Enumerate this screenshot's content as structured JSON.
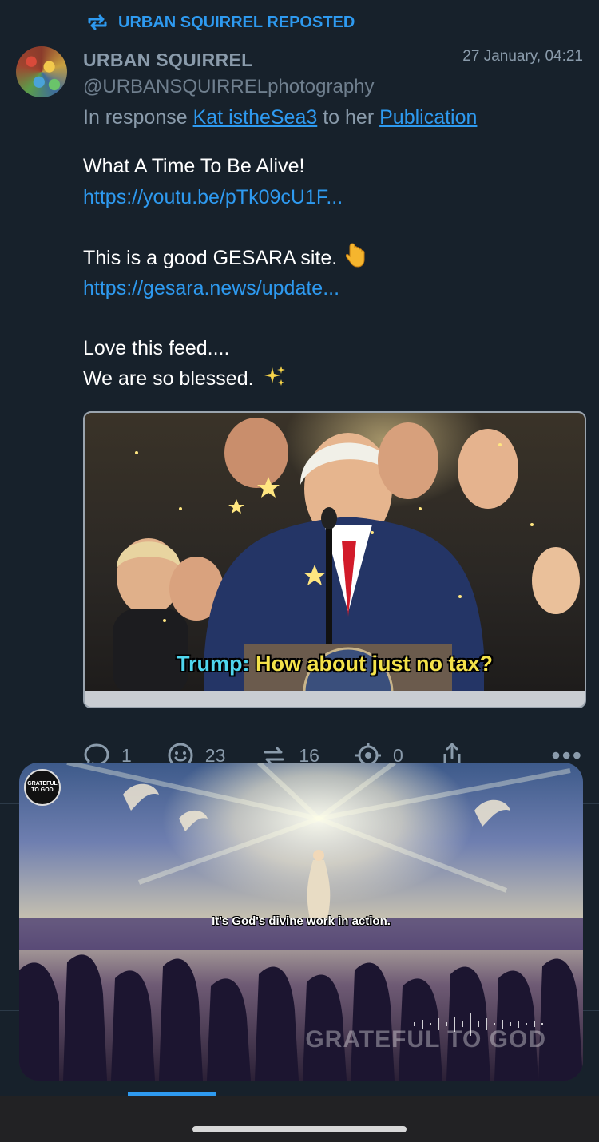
{
  "repost": {
    "label": "URBAN SQUIRREL REPOSTED"
  },
  "post": {
    "author_name": "URBAN SQUIRREL",
    "handle": "@URBANSQUIRRELphotography",
    "timestamp": "27 January, 04:21",
    "reply": {
      "prefix": "In response",
      "user_link": "Kat istheSea3",
      "middle": "to her",
      "publication_link": "Publication"
    },
    "text_line_1": "What A Time To Be Alive!",
    "link_1": "https://youtu.be/pTk09cU1F...",
    "text_line_2": "This is a good GESARA site.",
    "link_2": "https://gesara.news/update...",
    "text_line_3": "Love this feed....",
    "text_line_4": "We are so blessed.",
    "media": {
      "caption_speaker": "Trump:",
      "caption_text": " How about just no tax?"
    },
    "actions": {
      "comments": "1",
      "reactions": "23",
      "reposts": "16",
      "targets": "0"
    }
  },
  "video_overlay": {
    "channel_logo": "GRATEFUL TO GOD",
    "subtitle": "It's God's divine work in action.",
    "watermark": "GRATEFUL TO GOD"
  },
  "colors": {
    "background": "#17212b",
    "accent": "#2e9af0",
    "muted": "#8a9bab",
    "caption_yellow": "#f4e24a",
    "caption_cyan": "#4fd6ee"
  }
}
